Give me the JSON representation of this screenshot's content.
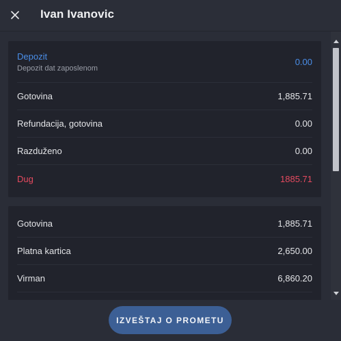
{
  "header": {
    "title": "Ivan Ivanovic",
    "close_icon": "close-icon"
  },
  "summary": {
    "deposit": {
      "label": "Depozit",
      "sublabel": "Depozit dat zaposlenom",
      "value": "0.00"
    },
    "rows": [
      {
        "label": "Gotovina",
        "value": "1,885.71"
      },
      {
        "label": "Refundacija, gotovina",
        "value": "0.00"
      },
      {
        "label": "Razduženo",
        "value": "0.00"
      }
    ],
    "debt": {
      "label": "Dug",
      "value": "1885.71"
    }
  },
  "payments": {
    "rows": [
      {
        "label": "Gotovina",
        "value": "1,885.71"
      },
      {
        "label": "Platna kartica",
        "value": "2,650.00"
      },
      {
        "label": "Virman",
        "value": "6,860.20"
      }
    ]
  },
  "footer": {
    "report_button_label": "IZVEŠTAJ O PROMETU"
  },
  "colors": {
    "accent_blue": "#4a8ee8",
    "debt_red": "#e54a5f",
    "button_bg": "#3c5f95"
  }
}
